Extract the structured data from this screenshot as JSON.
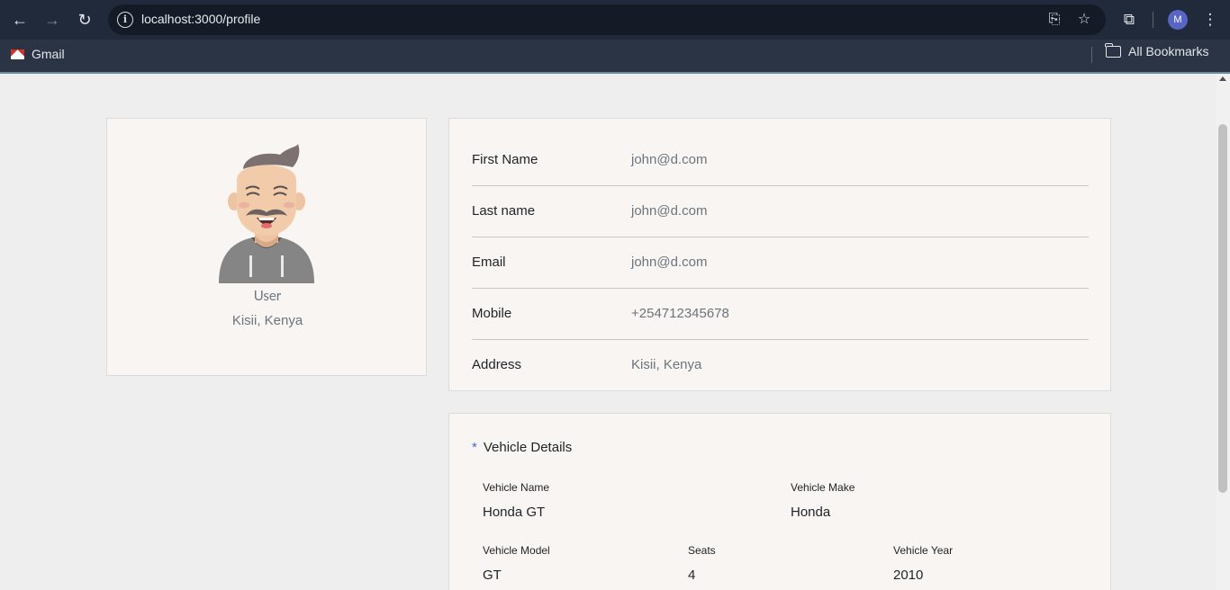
{
  "browser": {
    "url": "localhost:3000/profile",
    "profile_initial": "M",
    "bookmarks": [
      {
        "label": "Gmail"
      },
      {
        "label": "All Bookmarks"
      }
    ]
  },
  "profile": {
    "role": "User",
    "location": "Kisii, Kenya"
  },
  "details": [
    {
      "label": "First Name",
      "value": "john@d.com"
    },
    {
      "label": "Last name",
      "value": "john@d.com"
    },
    {
      "label": "Email",
      "value": "john@d.com"
    },
    {
      "label": "Mobile",
      "value": "+254712345678"
    },
    {
      "label": "Address",
      "value": "Kisii, Kenya"
    }
  ],
  "vehicle": {
    "marker": "*",
    "title": "Vehicle Details",
    "fields": [
      {
        "label": "Vehicle Name",
        "value": "Honda GT"
      },
      {
        "label": "Vehicle Make",
        "value": "Honda"
      },
      {
        "label": "Vehicle Model",
        "value": "GT"
      },
      {
        "label": "Seats",
        "value": "4"
      },
      {
        "label": "Vehicle Year",
        "value": "2010"
      }
    ]
  },
  "colors": {
    "page_bg": "#eeeeee",
    "card_bg": "#f8f5f3",
    "accent": "#3b6fc6",
    "muted_text": "#6c757d"
  }
}
